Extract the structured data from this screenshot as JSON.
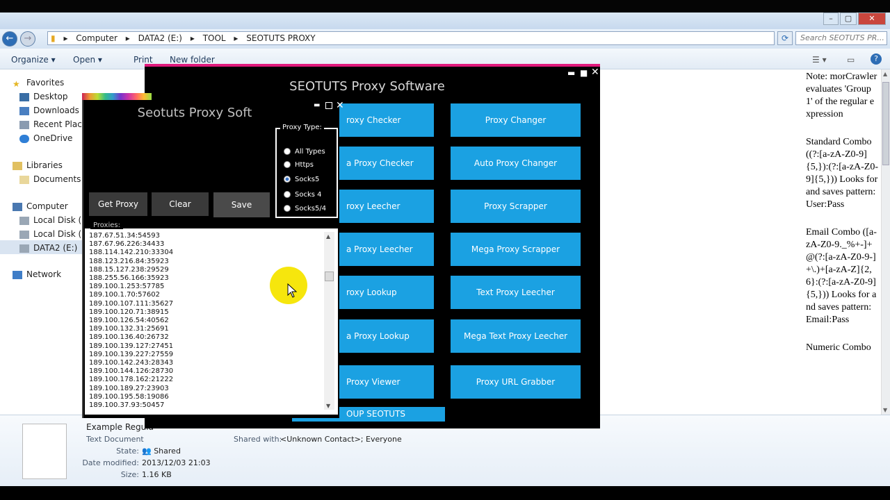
{
  "explorer": {
    "breadcrumb": [
      "Computer",
      "DATA2 (E:)",
      "TOOL",
      "SEOTUTS PROXY"
    ],
    "search_placeholder": "Search SEOTUTS PR...",
    "toolbar": {
      "organize": "Organize ▾",
      "open": "Open ▾",
      "print": "Print",
      "new_folder": "New folder"
    },
    "nav": {
      "favorites": "Favorites",
      "desktop": "Desktop",
      "downloads": "Downloads",
      "recent_places": "Recent Places",
      "onedrive": "OneDrive",
      "libraries": "Libraries",
      "documents": "Documents",
      "computer": "Computer",
      "local_c": "Local Disk (C:)",
      "local_d": "Local Disk (D:)",
      "data2": "DATA2 (E:)",
      "network": "Network"
    },
    "notes": [
      "Note: morCrawler evaluates 'Group 1' of the regular expression",
      "Standard Combo ((?:[a-zA-Z0-9]{5,}):(?:[a-zA-Z0-9]{5,})) Looks for and saves pattern: User:Pass",
      "Email Combo ([a-zA-Z0-9._%+-]+@(?:[a-zA-Z0-9-]+\\.)+[a-zA-Z]{2,6}:(?:[a-zA-Z0-9]{5,})) Looks for and saves pattern: Email:Pass",
      "Numeric Combo"
    ],
    "details": {
      "filename": "Example Regula",
      "filetype": "Text Document",
      "state_label": "State:",
      "state_value": "Shared",
      "modified_label": "Date modified:",
      "modified_value": "2013/12/03 21:03",
      "size_label": "Size:",
      "size_value": "1.16 KB",
      "shared_label": "Shared with:",
      "shared_value": "<Unknown Contact>; Everyone"
    }
  },
  "big_window": {
    "title": "SEOTUTS Proxy Software",
    "left_buttons": [
      "roxy Checker",
      "a Proxy Checker",
      "roxy Leecher",
      "a Proxy Leecher",
      "roxy Lookup",
      "a Proxy Lookup",
      "Proxy Viewer"
    ],
    "right_buttons": [
      "Proxy Changer",
      "Auto Proxy Changer",
      "Proxy Scrapper",
      "Mega Proxy Scrapper",
      "Text Proxy Leecher",
      "Mega Text Proxy Leecher",
      "Proxy URL Grabber"
    ],
    "footer_button": "OUP SEOTUTS"
  },
  "small_window": {
    "title": "Seotuts Proxy Soft",
    "buttons": {
      "get_proxy": "Get Proxy",
      "clear": "Clear",
      "save": "Save"
    },
    "proxy_type_label": "Proxy Type:",
    "proxy_types": [
      "All Types",
      "Https",
      "Socks5",
      "Socks 4",
      "Socks5/4"
    ],
    "selected_type": "Socks5",
    "proxies_label": "Proxies:",
    "proxies": [
      "187.67.51.34:54593",
      "187.67.96.226:34433",
      "188.114.142.210:33304",
      "188.123.216.84:35923",
      "188.15.127.238:29529",
      "188.255.56.166:35923",
      "189.100.1.253:57785",
      "189.100.1.70:57602",
      "189.100.107.111:35627",
      "189.100.120.71:38915",
      "189.100.126.54:40562",
      "189.100.132.31:25691",
      "189.100.136.40:26732",
      "189.100.139.127:27451",
      "189.100.139.227:27559",
      "189.100.142.243:28343",
      "189.100.144.126:28730",
      "189.100.178.162:21222",
      "189.100.189.27:23903",
      "189.100.195.58:19086",
      "189.100.37.93:50457"
    ]
  }
}
